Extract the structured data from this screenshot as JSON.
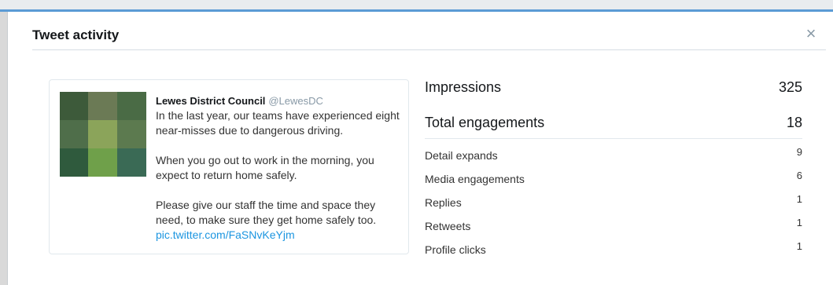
{
  "modal": {
    "title": "Tweet activity",
    "close_symbol": "×"
  },
  "tweet": {
    "author_name": "Lewes District Council",
    "author_handle": "@LewesDC",
    "paragraphs": [
      "In the last year, our teams have experienced eight near-misses due to dangerous driving.",
      "When you go out to work in the morning, you expect to return home safely.",
      "Please give our staff the time and space they need, to make sure they get home safely too."
    ],
    "link_text": "pic.twitter.com/FaSNvKeYjm",
    "media_colors": [
      "#3d5a3a",
      "#6b7a55",
      "#4a6b45",
      "#4f6e4a",
      "#8ba45a",
      "#5c7a4f",
      "#2f5a3d",
      "#6fa04a",
      "#3a6a55"
    ]
  },
  "stats": {
    "primary": [
      {
        "label": "Impressions",
        "value": "325"
      },
      {
        "label": "Total engagements",
        "value": "18"
      }
    ],
    "secondary": [
      {
        "label": "Detail expands",
        "value": "9"
      },
      {
        "label": "Media engagements",
        "value": "6"
      },
      {
        "label": "Replies",
        "value": "1"
      },
      {
        "label": "Retweets",
        "value": "1"
      },
      {
        "label": "Profile clicks",
        "value": "1"
      }
    ]
  }
}
